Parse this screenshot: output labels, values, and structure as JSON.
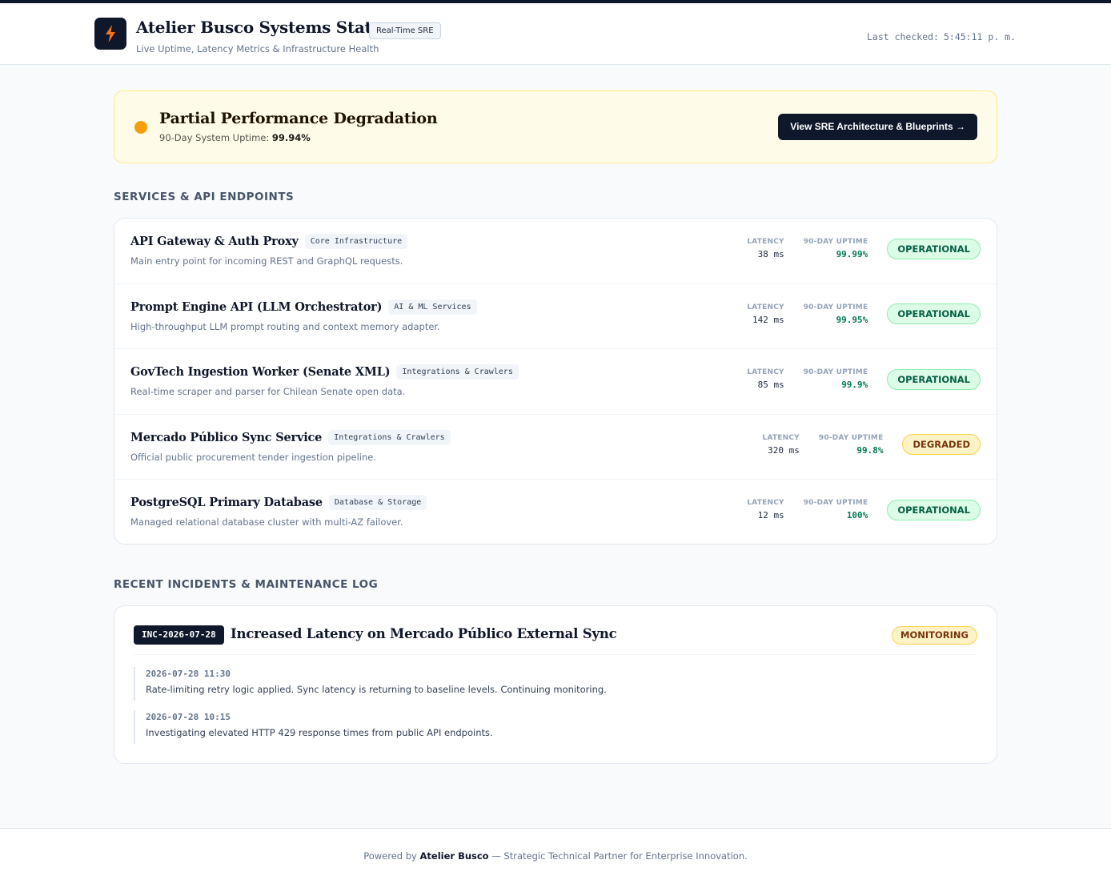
{
  "header": {
    "logo_icon": "lightning-bolt-icon",
    "title": "Atelier Busco Systems Status",
    "badge": "Real-Time SRE",
    "subtitle": "Live Uptime, Latency Metrics & Infrastructure Health",
    "last_checked_label": "Last checked:",
    "last_checked_value": "5:45:11 p. m."
  },
  "banner": {
    "title": "Partial Performance Degradation",
    "uptime_label": "90-Day System Uptime:",
    "uptime_value": "99.94%",
    "button_label": "View SRE Architecture & Blueprints →",
    "status_color": "#f59e0b"
  },
  "services": {
    "section_title": "SERVICES & API ENDPOINTS",
    "latency_label": "LATENCY",
    "uptime_label": "90-DAY UPTIME",
    "items": [
      {
        "name": "API Gateway & Auth Proxy",
        "tag": "Core Infrastructure",
        "description": "Main entry point for incoming REST and GraphQL requests.",
        "latency": "38 ms",
        "uptime": "99.99%",
        "status": "OPERATIONAL"
      },
      {
        "name": "Prompt Engine API (LLM Orchestrator)",
        "tag": "AI & ML Services",
        "description": "High-throughput LLM prompt routing and context memory adapter.",
        "latency": "142 ms",
        "uptime": "99.95%",
        "status": "OPERATIONAL"
      },
      {
        "name": "GovTech Ingestion Worker (Senate XML)",
        "tag": "Integrations & Crawlers",
        "description": "Real-time scraper and parser for Chilean Senate open data.",
        "latency": "85 ms",
        "uptime": "99.9%",
        "status": "OPERATIONAL"
      },
      {
        "name": "Mercado Público Sync Service",
        "tag": "Integrations & Crawlers",
        "description": "Official public procurement tender ingestion pipeline.",
        "latency": "320 ms",
        "uptime": "99.8%",
        "status": "DEGRADED"
      },
      {
        "name": "PostgreSQL Primary Database",
        "tag": "Database & Storage",
        "description": "Managed relational database cluster with multi-AZ failover.",
        "latency": "12 ms",
        "uptime": "100%",
        "status": "OPERATIONAL"
      }
    ]
  },
  "incidents": {
    "section_title": "RECENT INCIDENTS & MAINTENANCE LOG",
    "items": [
      {
        "id": "INC-2026-07-28",
        "title": "Increased Latency on Mercado Público External Sync",
        "status": "MONITORING",
        "updates": [
          {
            "time": "2026-07-28 11:30",
            "text": "Rate-limiting retry logic applied. Sync latency is returning to baseline levels. Continuing monitoring."
          },
          {
            "time": "2026-07-28 10:15",
            "text": "Investigating elevated HTTP 429 response times from public API endpoints."
          }
        ]
      }
    ]
  },
  "footer": {
    "prefix": "Powered by",
    "brand": "Atelier Busco",
    "suffix": "— Strategic Technical Partner for Enterprise Innovation."
  },
  "colors": {
    "operational": "#065f46",
    "degraded": "#78350f",
    "accent_dark": "#0f172a"
  }
}
